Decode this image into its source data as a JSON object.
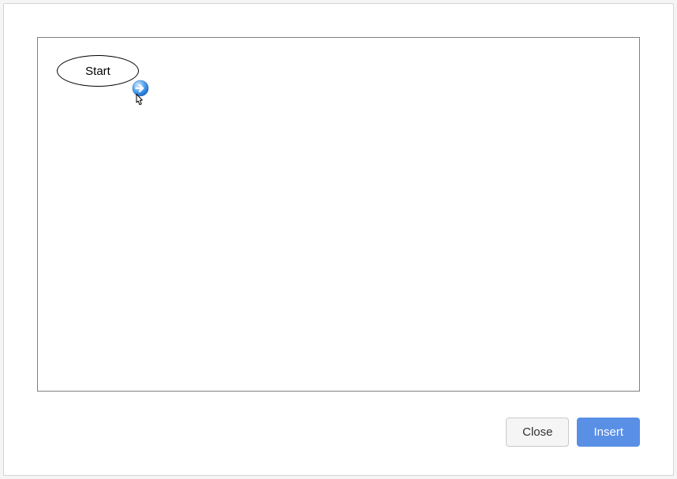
{
  "canvas": {
    "node_label": "Start"
  },
  "buttons": {
    "close_label": "Close",
    "insert_label": "Insert"
  }
}
